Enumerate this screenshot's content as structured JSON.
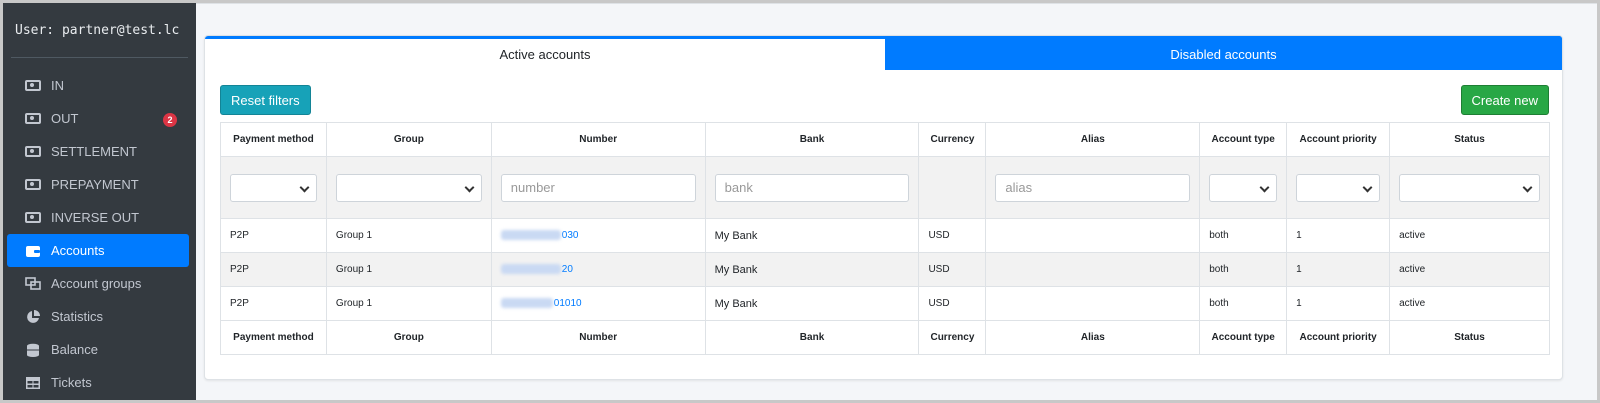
{
  "sidebar": {
    "user": "User: partner@test.lc",
    "items": [
      {
        "label": "IN",
        "icon": "money-bill-icon"
      },
      {
        "label": "OUT",
        "icon": "money-bill-icon",
        "badge": "2"
      },
      {
        "label": "SETTLEMENT",
        "icon": "money-bill-icon"
      },
      {
        "label": "PREPAYMENT",
        "icon": "money-bill-icon"
      },
      {
        "label": "INVERSE OUT",
        "icon": "money-bill-icon"
      },
      {
        "label": "Accounts",
        "icon": "wallet-icon",
        "active": true
      },
      {
        "label": "Account groups",
        "icon": "object-group-icon"
      },
      {
        "label": "Statistics",
        "icon": "chart-pie-icon"
      },
      {
        "label": "Balance",
        "icon": "coins-icon"
      },
      {
        "label": "Tickets",
        "icon": "table-icon"
      }
    ]
  },
  "tabs": {
    "active": "Active accounts",
    "disabled": "Disabled accounts"
  },
  "buttons": {
    "reset": "Reset filters",
    "create": "Create new"
  },
  "table": {
    "columns": [
      "Payment method",
      "Group",
      "Number",
      "Bank",
      "Currency",
      "Alias",
      "Account type",
      "Account priority",
      "Status"
    ],
    "filters": {
      "number_placeholder": "number",
      "bank_placeholder": "bank",
      "alias_placeholder": "alias"
    },
    "rows": [
      {
        "method": "P2P",
        "group": "Group 1",
        "number": "030",
        "bank": "My Bank",
        "currency": "USD",
        "alias": "",
        "type": "both",
        "priority": "1",
        "status": "active"
      },
      {
        "method": "P2P",
        "group": "Group 1",
        "number": "20",
        "bank": "My Bank",
        "currency": "USD",
        "alias": "",
        "type": "both",
        "priority": "1",
        "status": "active"
      },
      {
        "method": "P2P",
        "group": "Group 1",
        "number": "01010",
        "bank": "My Bank",
        "currency": "USD",
        "alias": "",
        "type": "both",
        "priority": "1",
        "status": "active"
      }
    ]
  },
  "colors": {
    "sidebar_bg": "#343a40",
    "primary": "#007bff",
    "info": "#17a2b8",
    "success": "#28a745",
    "danger": "#dc3545"
  }
}
